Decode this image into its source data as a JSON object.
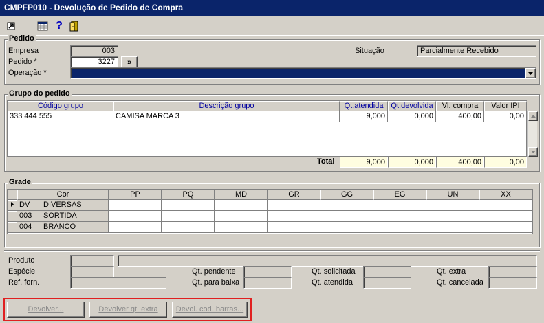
{
  "window": {
    "title": "CMPFP010 - Devolução de Pedido de Compra"
  },
  "toolbar": {
    "icons": [
      "exit-arrow-icon",
      "grid-icon",
      "help-icon",
      "door-exit-icon"
    ]
  },
  "pedido": {
    "section_title": "Pedido",
    "empresa_label": "Empresa",
    "empresa_value": "003",
    "pedido_label": "Pedido *",
    "pedido_value": "3227",
    "lookup_label": "»",
    "operacao_label": "Operação *",
    "operacao_value": "",
    "situacao_label": "Situação",
    "situacao_value": "Parcialmente Recebido"
  },
  "grupo": {
    "section_title": "Grupo do pedido",
    "headers": [
      "Código grupo",
      "Descrição grupo",
      "Qt.atendida",
      "Qt.devolvida",
      "Vl. compra",
      "Valor IPI"
    ],
    "rows": [
      [
        "333 444 555",
        "CAMISA MARCA 3",
        "9,000",
        "0,000",
        "400,00",
        "0,00"
      ]
    ],
    "total_label": "Total",
    "totals": [
      "9,000",
      "0,000",
      "400,00",
      "0,00"
    ]
  },
  "grade": {
    "section_title": "Grade",
    "headers": [
      "Cor",
      "PP",
      "PQ",
      "MD",
      "GR",
      "GG",
      "EG",
      "UN",
      "XX"
    ],
    "rows": [
      {
        "code": "DV",
        "name": "DIVERSAS"
      },
      {
        "code": "003",
        "name": "SORTIDA"
      },
      {
        "code": "004",
        "name": "BRANCO"
      }
    ]
  },
  "detalhes": {
    "produto_label": "Produto",
    "especie_label": "Espécie",
    "ref_forn_label": "Ref. forn.",
    "qt_pendente_label": "Qt. pendente",
    "qt_para_baixa_label": "Qt. para baixa",
    "qt_solicitada_label": "Qt. solicitada",
    "qt_atendida_label": "Qt. atendida",
    "qt_extra_label": "Qt. extra",
    "qt_cancelada_label": "Qt. cancelada"
  },
  "actions": {
    "devolver": "Devolver...",
    "devolver_extra": "Devolver qt. extra",
    "devol_barras": "Devol. cod. barras..."
  }
}
